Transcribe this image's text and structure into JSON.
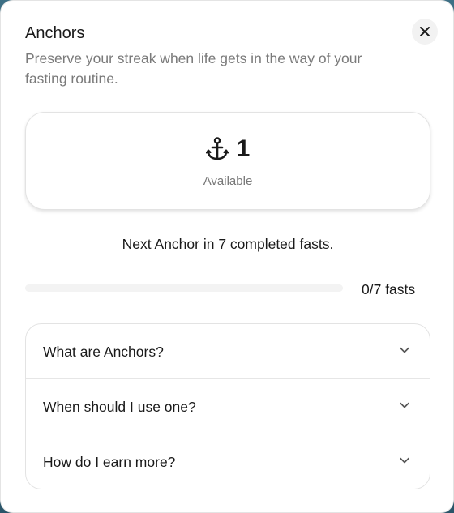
{
  "modal": {
    "title": "Anchors",
    "subtitle": "Preserve your streak when life gets in the way of your fasting routine."
  },
  "count_card": {
    "icon": "anchor-icon",
    "value": "1",
    "label": "Available"
  },
  "next_anchor": {
    "text": "Next Anchor in 7 completed fasts."
  },
  "progress": {
    "current": 0,
    "total": 7,
    "fraction": 0,
    "label": "0/7 fasts"
  },
  "faq": {
    "items": [
      {
        "question": "What are Anchors?"
      },
      {
        "question": "When should I use one?"
      },
      {
        "question": "How do I earn more?"
      }
    ]
  },
  "colors": {
    "text": "#1a1a1a",
    "muted": "#7a7a7a",
    "border": "#e3e3e3",
    "track": "#f3f3f3"
  }
}
